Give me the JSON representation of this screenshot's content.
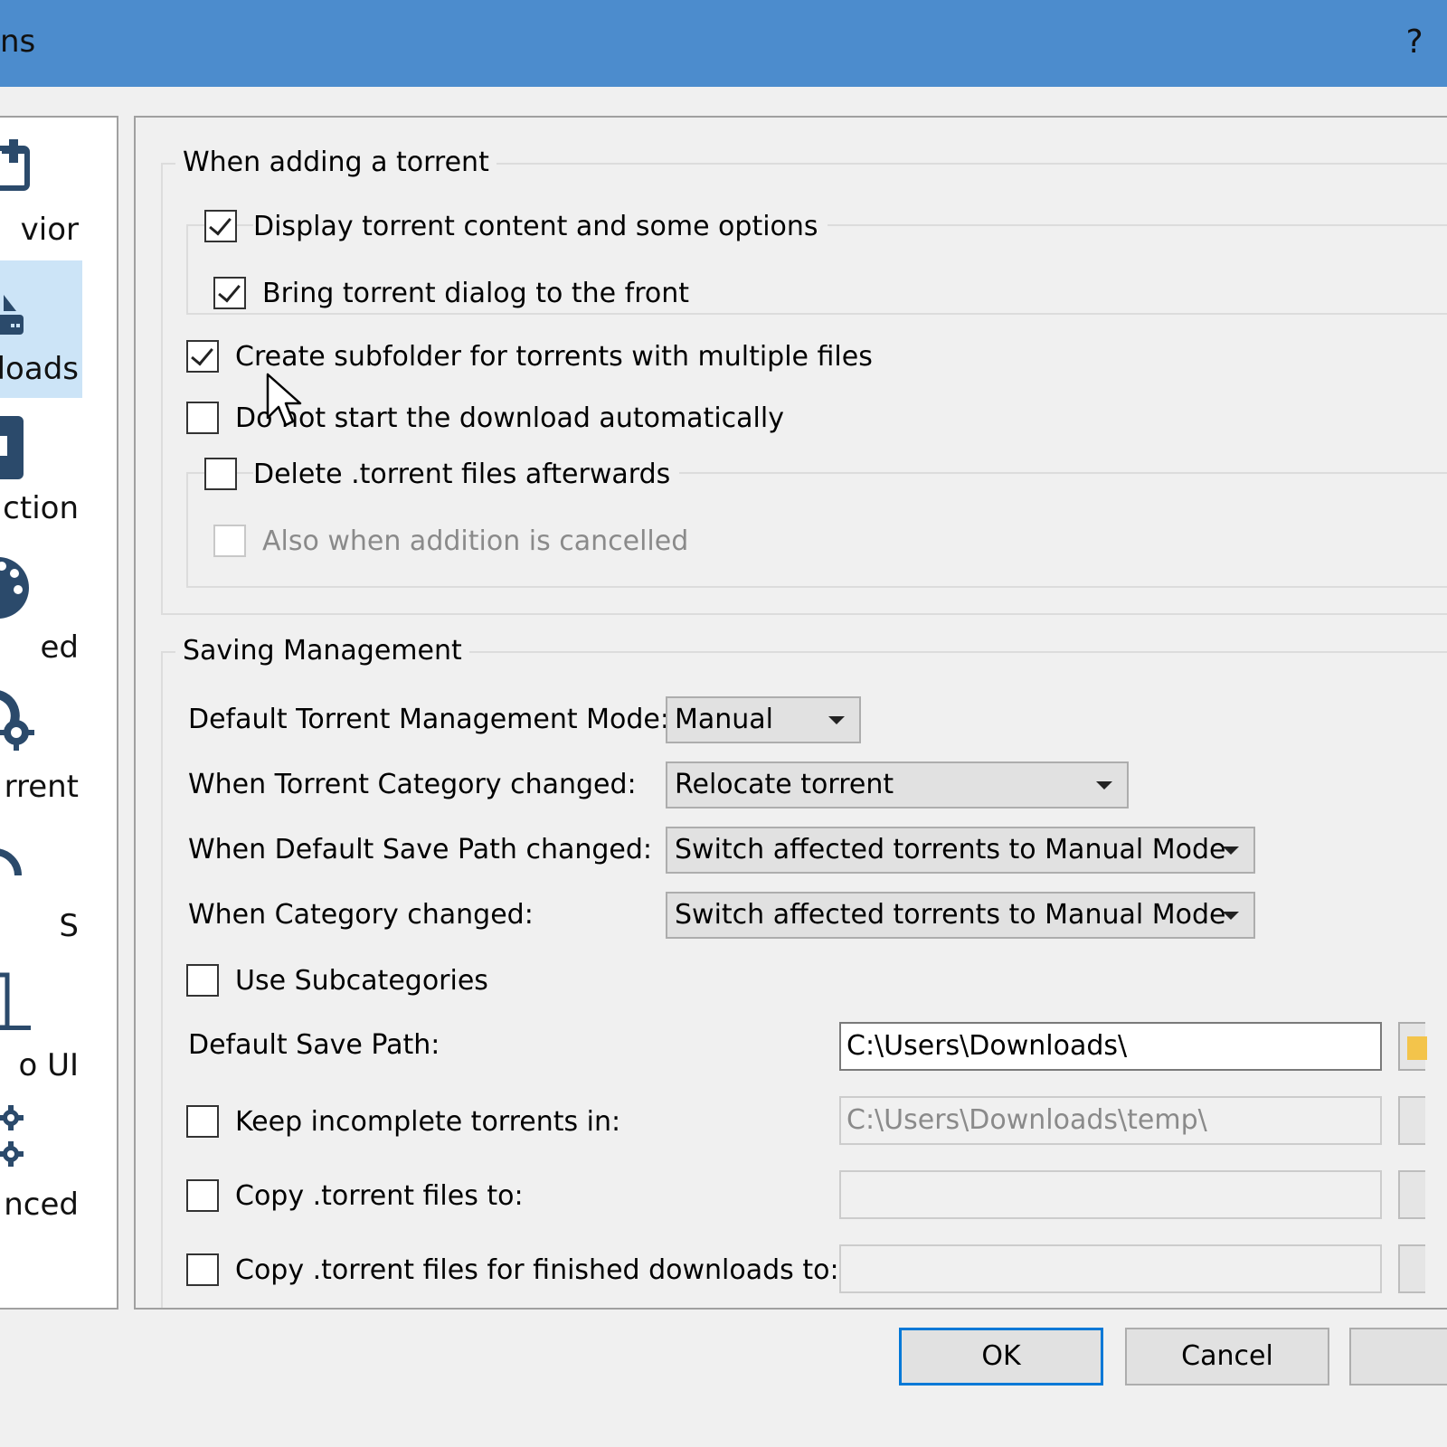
{
  "window": {
    "title": "ns",
    "help_label": "?"
  },
  "sidebar": {
    "items": [
      {
        "label": "vior",
        "icon": "behavior-icon",
        "selected": false
      },
      {
        "label": "loads",
        "icon": "downloads-icon",
        "selected": true
      },
      {
        "label": "ction",
        "icon": "connection-icon",
        "selected": false
      },
      {
        "label": "ed",
        "icon": "speed-icon",
        "selected": false
      },
      {
        "label": "rrent",
        "icon": "bittorrent-icon",
        "selected": false
      },
      {
        "label": "S",
        "icon": "rss-icon",
        "selected": false
      },
      {
        "label": "o UI",
        "icon": "web-ui-icon",
        "selected": false
      },
      {
        "label": "nced",
        "icon": "advanced-icon",
        "selected": false
      }
    ]
  },
  "adding": {
    "title": "When adding a torrent",
    "display_content": {
      "label": "Display torrent content and some options",
      "checked": true
    },
    "bring_front": {
      "label": "Bring torrent dialog to the front",
      "checked": true
    },
    "create_subfolder": {
      "label": "Create subfolder for torrents with multiple files",
      "checked": true
    },
    "dont_start": {
      "label": "Do not start the download automatically",
      "checked": false
    },
    "delete_torrent": {
      "label": "Delete .torrent files afterwards",
      "checked": false
    },
    "also_cancelled": {
      "label": "Also when addition is cancelled",
      "checked": false,
      "enabled": false
    }
  },
  "saving": {
    "title": "Saving Management",
    "mode_label": "Default Torrent Management Mode:",
    "mode_value": "Manual",
    "category_changed_label": "When Torrent Category changed:",
    "category_changed_value": "Relocate torrent",
    "save_path_changed_label": "When Default Save Path changed:",
    "save_path_changed_value": "Switch affected torrents to Manual Mode",
    "cat_changed_label": "When Category changed:",
    "cat_changed_value": "Switch affected torrents to Manual Mode",
    "subcategories": {
      "label": "Use Subcategories",
      "checked": false
    },
    "default_path_label": "Default Save Path:",
    "default_path_value": "C:\\Users\\Downloads\\",
    "keep_incomplete": {
      "label": "Keep incomplete torrents in:",
      "checked": false,
      "value": "C:\\Users\\Downloads\\temp\\"
    },
    "copy_torrent": {
      "label": "Copy .torrent files to:",
      "checked": false,
      "value": ""
    },
    "copy_finished": {
      "label": "Copy .torrent files for finished downloads to:",
      "checked": false,
      "value": ""
    }
  },
  "buttons": {
    "ok": "OK",
    "cancel": "Cancel"
  },
  "colors": {
    "titlebar": "#4c8ccd",
    "selected": "#cce4f7",
    "icon": "#2b4a6b",
    "default_button_border": "#0078d7"
  }
}
